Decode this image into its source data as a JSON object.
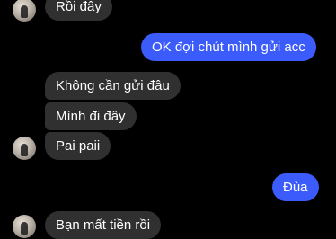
{
  "chat": {
    "messages": [
      {
        "id": "m1",
        "direction": "in",
        "text": "Rồi đây"
      },
      {
        "id": "m2",
        "direction": "out",
        "text": "OK đợi chút mình gửi acc"
      },
      {
        "id": "m3",
        "direction": "in",
        "text": "Không cần gửi đâu"
      },
      {
        "id": "m4",
        "direction": "in",
        "text": "Mình đi đây"
      },
      {
        "id": "m5",
        "direction": "in",
        "text": "Pai paii"
      },
      {
        "id": "m6",
        "direction": "out",
        "text": "Đùa"
      },
      {
        "id": "m7",
        "direction": "in",
        "text": "Bạn mất tiền rồi"
      }
    ]
  },
  "colors": {
    "background": "#000000",
    "incoming_bubble": "#303030",
    "outgoing_bubble": "#3b5bfb",
    "text": "#ffffff"
  }
}
